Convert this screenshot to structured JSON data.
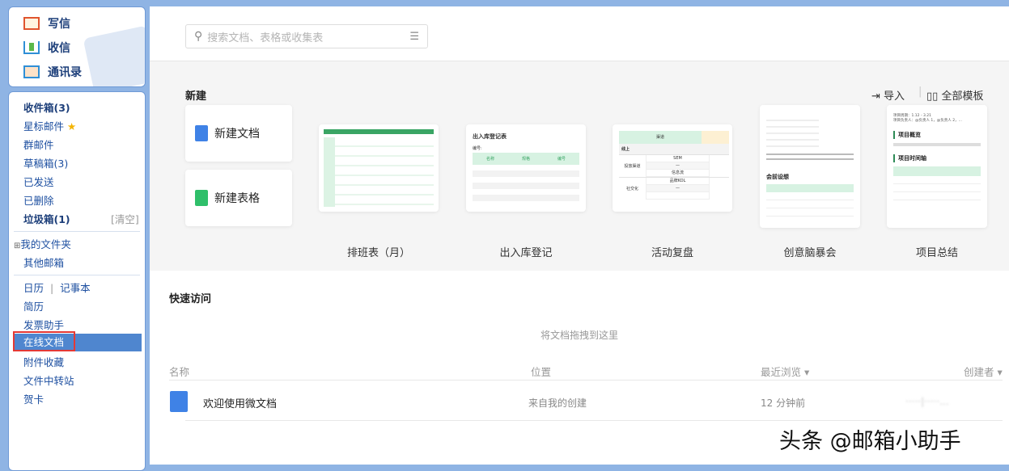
{
  "sidebar": {
    "top": [
      {
        "label": "写信",
        "icon": "compose-icon"
      },
      {
        "label": "收信",
        "icon": "receive-icon"
      },
      {
        "label": "通讯录",
        "icon": "contacts-icon"
      }
    ],
    "folders": [
      "收件箱(3)",
      "星标邮件",
      "群邮件",
      "草稿箱(3)",
      "已发送",
      "已删除",
      "垃圾箱(1)"
    ],
    "clear": "[清空]",
    "my_folders": "我的文件夹",
    "other_mail": "其他邮箱",
    "calendar": "日历",
    "notes": "记事本",
    "sep": "|",
    "tools": [
      "简历",
      "发票助手",
      "在线文档",
      "附件收藏",
      "文件中转站",
      "贺卡"
    ]
  },
  "search": {
    "placeholder": "搜索文档、表格或收集表"
  },
  "new": {
    "title": "新建",
    "import": "导入",
    "all_templates": "全部模板",
    "new_doc": "新建文档",
    "new_sheet": "新建表格"
  },
  "templates": [
    {
      "label": "排班表（月）"
    },
    {
      "label": "出入库登记",
      "heading": "出入库登记表",
      "sub": "编号:",
      "cols": [
        "名称",
        "规格",
        "编号"
      ]
    },
    {
      "label": "活动复盘",
      "cells": [
        "渠道",
        "线上",
        "SEM",
        "投放渠道",
        "信息流",
        "品牌KOL",
        "社交化"
      ]
    },
    {
      "label": "创意脑暴会",
      "heading": "会前设想"
    },
    {
      "label": "项目总结",
      "lines": [
        "项目周期：1.12 - 3.21",
        "项目负责人：@负责人 1，@负责人 2，..."
      ],
      "h1": "项目概览",
      "h2": "项目时间轴"
    }
  ],
  "quick": {
    "title": "快速访问",
    "drop_hint": "将文档拖拽到这里"
  },
  "table": {
    "headers": [
      "名称",
      "位置",
      "最近浏览 ▾",
      "创建者 ▾"
    ],
    "rows": [
      {
        "name": "欢迎使用微文档",
        "location": "来自我的创建",
        "viewed": "12 分钟前",
        "creator": "·····|·····..."
      }
    ]
  },
  "watermark": "头条 @邮箱小助手",
  "colors": {
    "accent": "#4f86cf",
    "doc_blue": "#3f82e6",
    "sheet_green": "#2fbf6a"
  }
}
